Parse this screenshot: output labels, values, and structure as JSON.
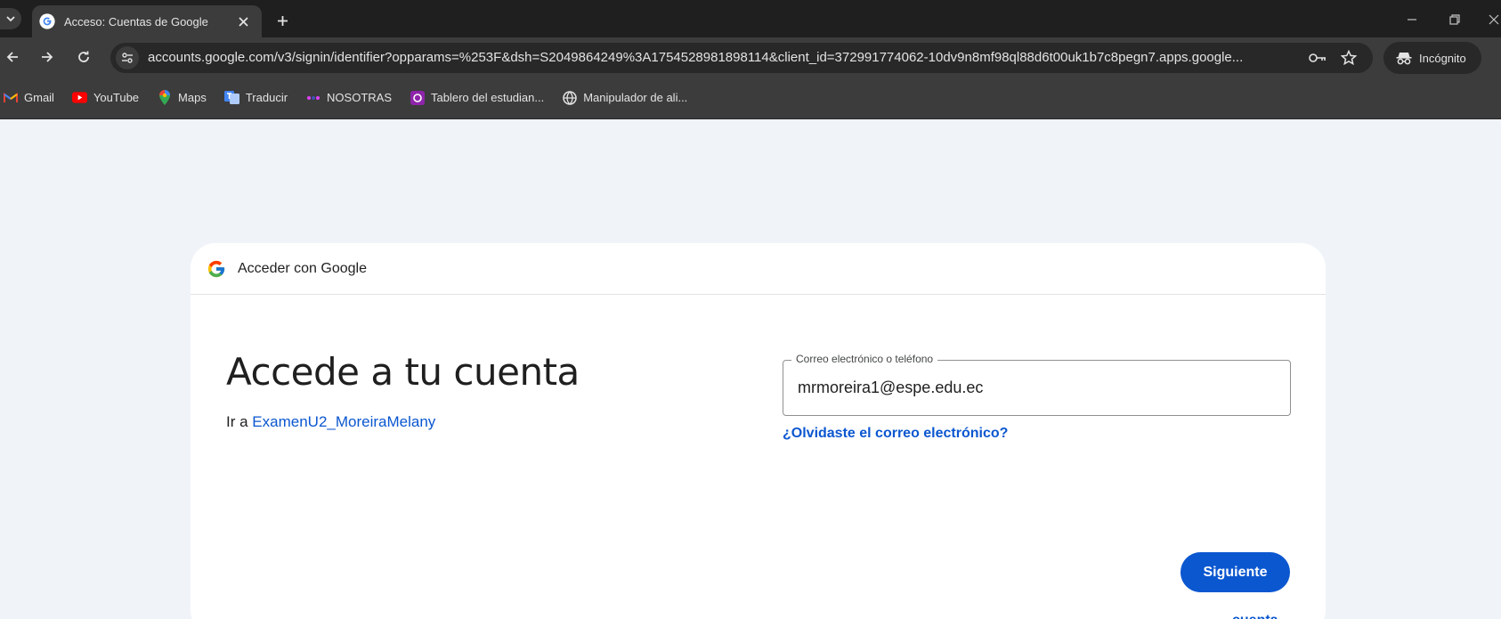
{
  "browser": {
    "tab": {
      "title": "Acceso: Cuentas de Google"
    },
    "url": "accounts.google.com/v3/signin/identifier?opparams=%253F&dsh=S2049864249%3A1754528981898114&client_id=372991774062-10dv9n8mf98ql88d6t00uk1b7c8pegn7.apps.google...",
    "incognito_label": "Incógnito",
    "bookmarks": [
      {
        "label": "Gmail",
        "icon": "gmail-icon"
      },
      {
        "label": "YouTube",
        "icon": "youtube-icon"
      },
      {
        "label": "Maps",
        "icon": "maps-icon"
      },
      {
        "label": "Traducir",
        "icon": "translate-icon"
      },
      {
        "label": "NOSOTRAS",
        "icon": "nosotras-icon"
      },
      {
        "label": "Tablero del estudian...",
        "icon": "dashboard-icon"
      },
      {
        "label": "Manipulador de ali...",
        "icon": "globe-icon"
      }
    ]
  },
  "signin": {
    "header_label": "Acceder con Google",
    "heading": "Accede a tu cuenta",
    "goto_prefix": "Ir a",
    "app_name": "ExamenU2_MoreiraMelany",
    "email_label": "Correo electrónico o teléfono",
    "email_value": "mrmoreira1@espe.edu.ec",
    "forgot_email": "¿Olvidaste el correo electrónico?",
    "create_account": "Crear cuenta",
    "next": "Siguiente"
  },
  "colors": {
    "accent": "#0b57d0",
    "page_bg": "#f0f4f9",
    "chrome_dark": "#1f1f1f",
    "chrome_toolbar": "#3c3c3c"
  }
}
